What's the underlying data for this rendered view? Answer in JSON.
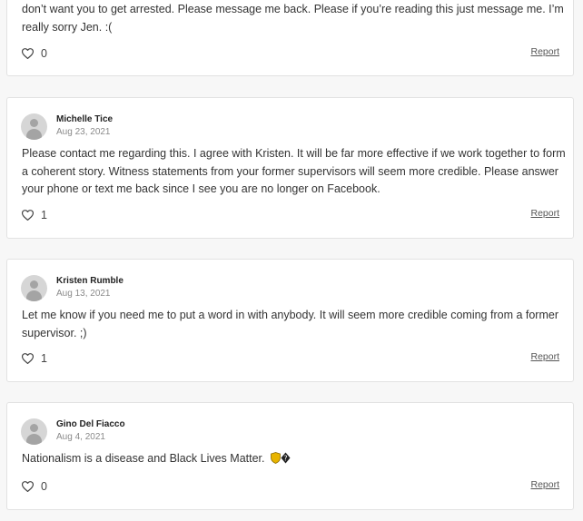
{
  "comments": [
    {
      "body": "don’t want you to get arrested. Please message me back. Please if you’re reading this just message me. I’m really sorry Jen. :(",
      "likes": "0",
      "report_label": "Report"
    },
    {
      "author": "Michelle Tice",
      "date": "Aug 23, 2021",
      "body": "Please contact me regarding this. I agree with Kristen. It will be far more effective if we work together to form a coherent story. Witness statements from your former supervisors will seem more credible. Please answer your phone or text me back since I see you are no longer on Facebook.",
      "likes": "1",
      "report_label": "Report"
    },
    {
      "author": "Kristen Rumble",
      "date": "Aug 13, 2021",
      "body": "Let me know if you need me to put a word in with anybody. It will seem more credible coming from a former supervisor. ;)",
      "likes": "1",
      "report_label": "Report"
    },
    {
      "author": "Gino Del Fiacco",
      "date": "Aug 4, 2021",
      "body": "Nationalism is a disease and Black Lives Matter.",
      "body_suffix": "🛡�",
      "likes": "0",
      "report_label": "Report"
    }
  ],
  "icons": {
    "like": "heart-outline-icon",
    "avatar": "default-avatar-icon"
  },
  "colors": {
    "card_background": "#ffffff",
    "card_border": "#e2e2e2",
    "page_background": "#f7f7f7",
    "text": "#333333",
    "muted_text": "#8a8a8a"
  }
}
